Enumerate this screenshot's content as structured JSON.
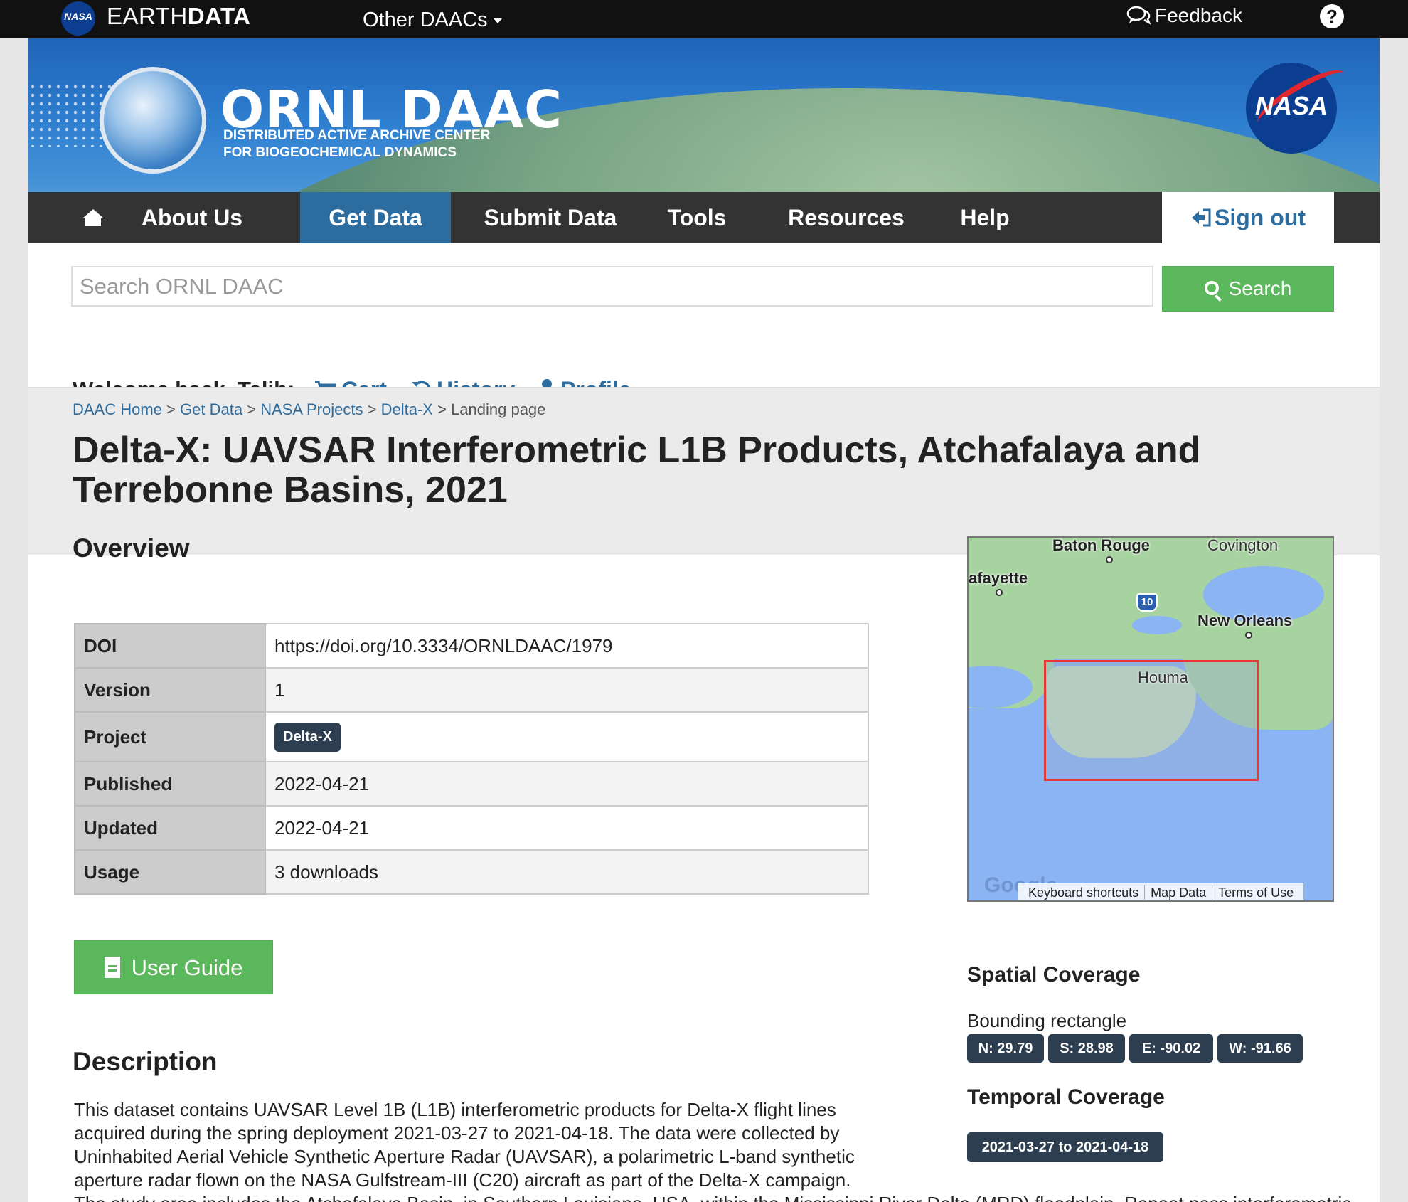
{
  "topbar": {
    "nasa_badge": "NASA",
    "brand_light": "EARTH",
    "brand_bold": "DATA",
    "other_daacs": "Other DAACs",
    "feedback": "Feedback",
    "help": "?"
  },
  "banner": {
    "title": "ORNL DAAC",
    "subtitle_line1": "DISTRIBUTED ACTIVE ARCHIVE CENTER",
    "subtitle_line2": "FOR BIOGEOCHEMICAL DYNAMICS",
    "nasa_logo": "NASA"
  },
  "nav": {
    "items": [
      "About Us",
      "Get Data",
      "Submit Data",
      "Tools",
      "Resources",
      "Help"
    ],
    "active": "Get Data",
    "sign_out": "Sign out"
  },
  "search": {
    "placeholder": "Search ORNL DAAC",
    "button": "Search"
  },
  "user": {
    "welcome": "Welcome back, Talib:",
    "cart": "Cart",
    "history": "History",
    "profile": "Profile"
  },
  "breadcrumb": {
    "items": [
      "DAAC Home",
      "Get Data",
      "NASA Projects",
      "Delta-X"
    ],
    "current": "Landing page",
    "separator": ">"
  },
  "page": {
    "title": "Delta-X: UAVSAR Interferometric L1B Products, Atchafalaya and Terrebonne Basins, 2021"
  },
  "overview": {
    "heading": "Overview",
    "rows": [
      {
        "key": "DOI",
        "value": "https://doi.org/10.3334/ORNLDAAC/1979"
      },
      {
        "key": "Version",
        "value": "1"
      },
      {
        "key": "Project",
        "value": "Delta-X"
      },
      {
        "key": "Published",
        "value": "2022-04-21"
      },
      {
        "key": "Updated",
        "value": "2022-04-21"
      },
      {
        "key": "Usage",
        "value": "3 downloads"
      }
    ],
    "user_guide": "User Guide"
  },
  "map": {
    "labels": [
      "Baton Rouge",
      "Covington",
      "afayette",
      "New Orleans",
      "Houma"
    ],
    "highway_shield": "10",
    "google_logo": "Google",
    "attribution": [
      "Keyboard shortcuts",
      "Map Data",
      "Terms of Use"
    ]
  },
  "spatial": {
    "heading": "Spatial Coverage",
    "label": "Bounding rectangle",
    "north": "N: 29.79",
    "south": "S: 28.98",
    "east": "E: -90.02",
    "west": "W: -91.66"
  },
  "temporal": {
    "heading": "Temporal Coverage",
    "range": "2021-03-27 to 2021-04-18"
  },
  "description": {
    "heading": "Description",
    "p1": "This dataset contains UAVSAR Level 1B (L1B) interferometric products for Delta-X flight lines acquired during the spring deployment 2021-03-27 to 2021-04-18. The data were collected by Uninhabited Aerial Vehicle Synthetic Aperture Radar (UAVSAR), a polarimetric L-band synthetic aperture radar flown on the NASA Gulfstream-III (C20) aircraft as part of the Delta-X campaign.",
    "p2": "The study area includes the Atchafalaya Basin, in Southern Louisiana, USA, within the Mississippi River Delta (MRD) floodplain. Repeat pass interferometric synthetic aperture (InSAR) data are a standard UAVSAR product delivered by the UAVSAR processing team. For this dataset, a set of"
  }
}
